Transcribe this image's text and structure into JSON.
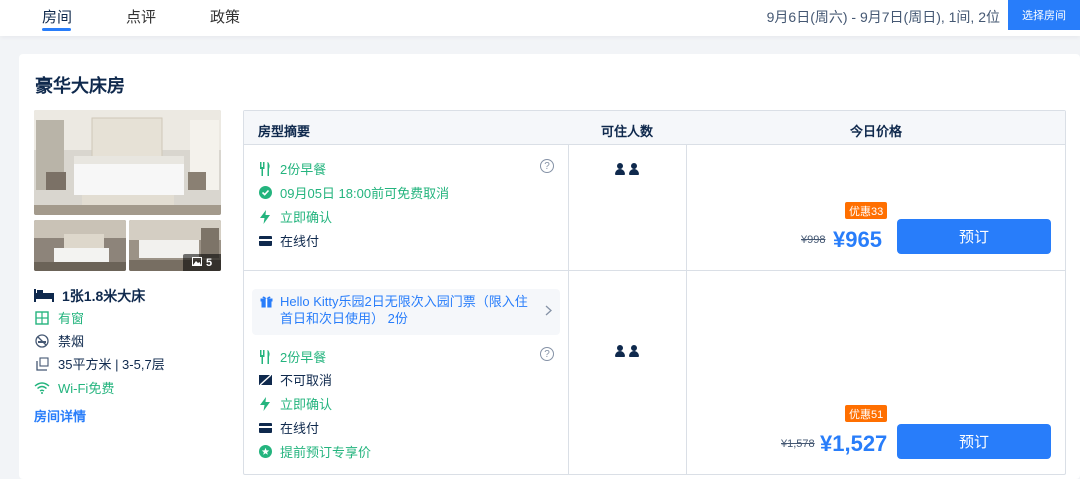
{
  "nav": {
    "tabs": [
      {
        "label": "房间"
      },
      {
        "label": "点评"
      },
      {
        "label": "政策"
      }
    ],
    "date_summary": "9月6日(周六) - 9月7日(周日), 1间, 2位",
    "choose_room_label": "选择房间"
  },
  "room": {
    "name": "豪华大床房",
    "photo_count": "5",
    "bed": "1张1.8米大床",
    "amenities": {
      "window": "有窗",
      "smoking": "禁烟",
      "size": "35平方米 | 3-5,7层",
      "wifi": "Wi-Fi免费"
    },
    "details_link": "房间详情"
  },
  "table": {
    "headers": {
      "summary": "房型摘要",
      "occupancy": "可住人数",
      "price": "今日价格"
    },
    "rows": [
      {
        "features": {
          "breakfast": "2份早餐",
          "cancel": "09月05日 18:00前可免费取消",
          "confirm": "立即确认",
          "payment": "在线付"
        },
        "help": "?",
        "badge": "优惠33",
        "original_price": "¥998",
        "price": "¥965",
        "book_label": "预订"
      },
      {
        "gift": "Hello Kitty乐园2日无限次入园门票（限入住首日和次日使用） 2份",
        "features": {
          "breakfast": "2份早餐",
          "cancel": "不可取消",
          "confirm": "立即确认",
          "payment": "在线付",
          "promo": "提前预订专享价"
        },
        "help": "?",
        "badge": "优惠51",
        "original_price": "¥1,578",
        "price": "¥1,527",
        "book_label": "预订"
      }
    ]
  },
  "colors": {
    "accent": "#287dfa",
    "green": "#24b47e",
    "badge": "#ff6f00",
    "text": "#0f294d"
  }
}
